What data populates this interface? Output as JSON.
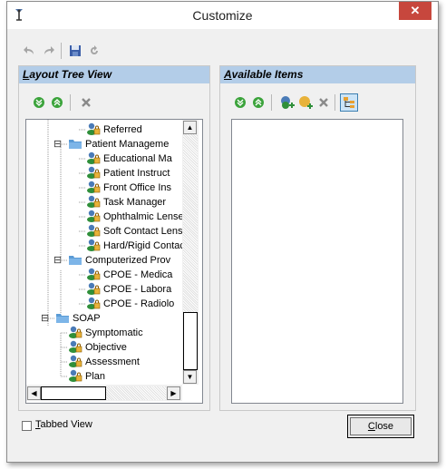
{
  "window": {
    "title": "Customize",
    "close_glyph": "✕"
  },
  "toolbar": {
    "icons": [
      "undo-icon",
      "redo-icon",
      "save-icon",
      "refresh-icon"
    ]
  },
  "layout_panel": {
    "title_ul": "L",
    "title_rest": "ayout Tree View",
    "icons": [
      "expand-all-icon",
      "collapse-all-icon",
      "delete-icon"
    ],
    "tree": [
      {
        "label": "Referred",
        "type": "item"
      },
      {
        "label": "Patient Manageme",
        "type": "folder",
        "expander": "⊟"
      },
      {
        "label": "Educational Ma",
        "type": "item"
      },
      {
        "label": "Patient Instruct",
        "type": "item"
      },
      {
        "label": "Front Office Ins",
        "type": "item"
      },
      {
        "label": "Task Manager",
        "type": "item"
      },
      {
        "label": "Ophthalmic Lenses",
        "type": "item"
      },
      {
        "label": "Soft Contact Lense",
        "type": "item"
      },
      {
        "label": "Hard/Rigid Contac",
        "type": "item"
      },
      {
        "label": "Computerized Prov",
        "type": "folder",
        "expander": "⊟"
      },
      {
        "label": "CPOE - Medica",
        "type": "item"
      },
      {
        "label": "CPOE - Labora",
        "type": "item"
      },
      {
        "label": "CPOE - Radiolo",
        "type": "item"
      },
      {
        "label": "SOAP",
        "type": "folder",
        "expander": "⊟"
      },
      {
        "label": "Symptomatic",
        "type": "item"
      },
      {
        "label": "Objective",
        "type": "item"
      },
      {
        "label": "Assessment",
        "type": "item"
      },
      {
        "label": "Plan",
        "type": "item"
      }
    ]
  },
  "available_panel": {
    "title_ul": "A",
    "title_rest": "vailable Items",
    "icons": [
      "expand-all-icon",
      "collapse-all-icon",
      "add-item-icon",
      "add-group-icon",
      "delete-icon",
      "tree-view-icon"
    ]
  },
  "scroll": {
    "up": "▲",
    "down": "▼",
    "left": "◀",
    "right": "▶"
  },
  "footer": {
    "tabbed_ul": "T",
    "tabbed_rest": "abbed View",
    "tabbed_checked": false,
    "close_ul": "C",
    "close_rest": "lose"
  }
}
